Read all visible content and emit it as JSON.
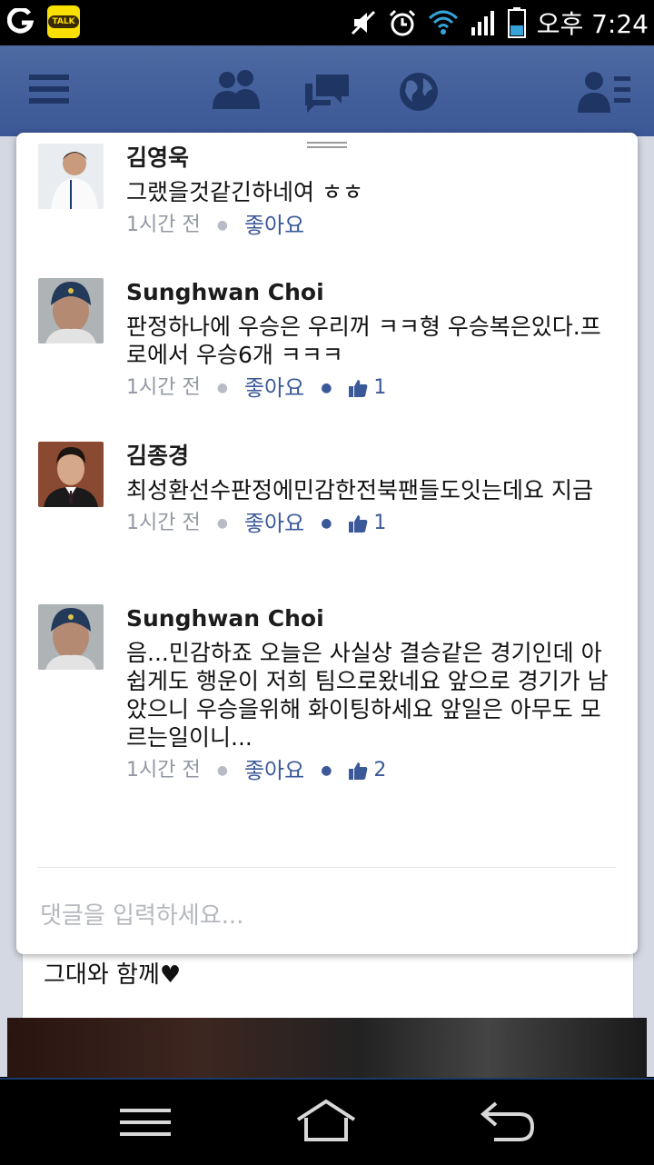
{
  "status_bar": {
    "time": "오후 7:24",
    "icons": [
      "g-app-icon",
      "kakaotalk-icon",
      "mute-icon",
      "alarm-icon",
      "wifi-icon",
      "signal-icon",
      "battery-icon"
    ],
    "kakao_label": "TALK"
  },
  "top_bar": {
    "icons": [
      "menu-icon",
      "friend-requests-icon",
      "messages-icon",
      "notifications-globe-icon",
      "contacts-icon"
    ],
    "color": "#3b5795"
  },
  "comments": [
    {
      "name": "김영욱",
      "text": "그랬을것같긴하네여 ㅎㅎ",
      "time": "1시간 전",
      "like_label": "좋아요",
      "likes": ""
    },
    {
      "name": "Sunghwan Choi",
      "text": "판정하나에 우승은 우리꺼 ㅋㅋ형 우승복은있다.프로에서 우승6개 ㅋㅋㅋ",
      "time": "1시간 전",
      "like_label": "좋아요",
      "likes": "1"
    },
    {
      "name": "김종경",
      "text": "최성환선수판정에민감한전북팬들도잇는데요 지금",
      "time": "1시간 전",
      "like_label": "좋아요",
      "likes": "1"
    },
    {
      "name": "Sunghwan Choi",
      "text": "음...민감하죠 오늘은 사실상 결승같은 경기인데 아쉽게도 행운이 저희 팀으로왔네요 앞으로 경기가 남았으니 우승을위해 화이팅하세요 앞일은 아무도 모르는일이니...",
      "time": "1시간 전",
      "like_label": "좋아요",
      "likes": "2"
    }
  ],
  "comment_input": {
    "placeholder": "댓글을 입력하세요..."
  },
  "background_post": {
    "text": "그대와 함께♥"
  },
  "nav_bar": {
    "icons": [
      "menu-icon",
      "home-icon",
      "back-icon"
    ]
  }
}
